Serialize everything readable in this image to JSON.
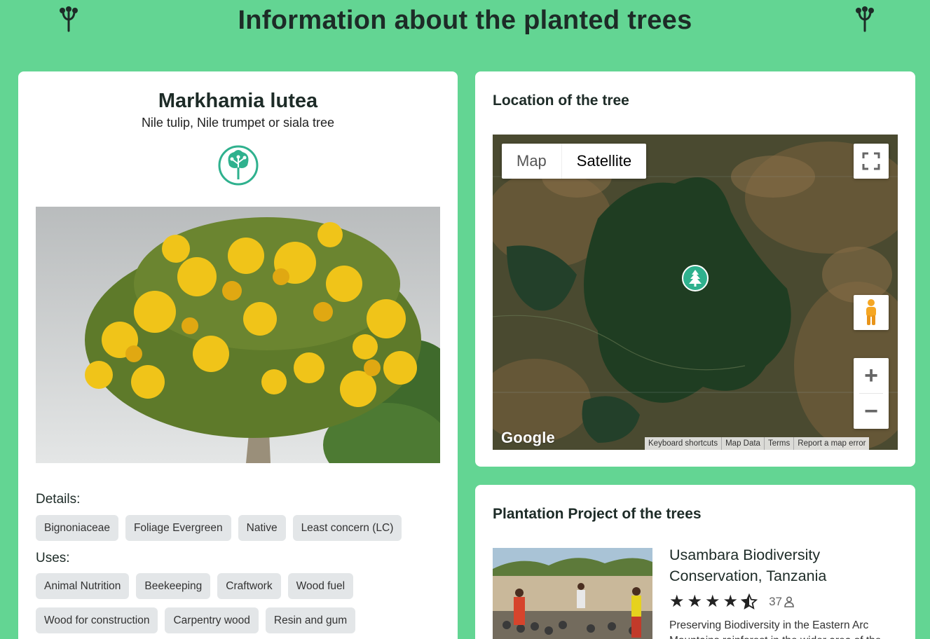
{
  "page": {
    "title": "Information about the planted trees",
    "header_icon": "tree-branch-icon"
  },
  "species": {
    "scientific_name": "Markhamia lutea",
    "common_names": "Nile tulip, Nile trumpet or siala tree",
    "logo_icon": "tree-circle-logo",
    "photo_alt": "Markhamia lutea tree in bloom"
  },
  "details": {
    "label": "Details:",
    "tags": [
      "Bignoniaceae",
      "Foliage Evergreen",
      "Native",
      "Least concern (LC)"
    ]
  },
  "uses": {
    "label": "Uses:",
    "tags": [
      "Animal Nutrition",
      "Beekeeping",
      "Craftwork",
      "Wood fuel",
      "Wood for construction",
      "Carpentry wood",
      "Resin and gum"
    ]
  },
  "location": {
    "heading": "Location of the tree",
    "map_types": [
      "Map",
      "Satellite"
    ],
    "selected_map_type": "Satellite",
    "zoom_in": "+",
    "zoom_out": "−",
    "provider": "Google",
    "footer_links": [
      "Keyboard shortcuts",
      "Map Data",
      "Terms",
      "Report a map error"
    ],
    "marker_icon": "tree-pin-icon"
  },
  "project": {
    "heading": "Plantation Project of the trees",
    "name": "Usambara Biodiversity Conservation, Tanzania",
    "rating_stars": 4.5,
    "rating_count": "37",
    "description": "Preserving Biodiversity in the Eastern Arc Mountains rainforest in the wider area of the"
  },
  "colors": {
    "background": "#63d593",
    "accent": "#2fb18e",
    "chip": "#e3e6e8"
  }
}
